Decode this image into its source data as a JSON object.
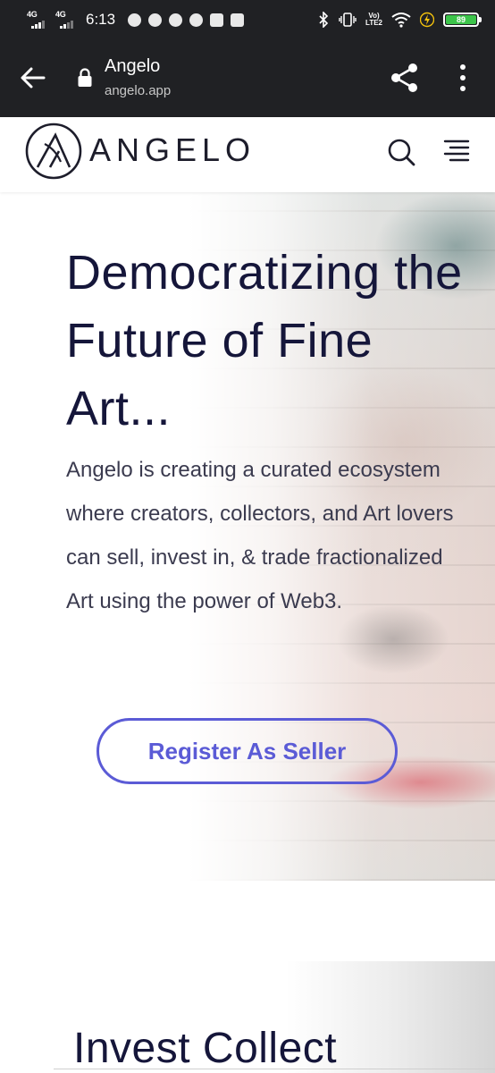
{
  "status_bar": {
    "network1": "4G",
    "network2": "4G",
    "time": "6:13",
    "volte_top": "Vo)",
    "volte_bottom": "LTE2",
    "battery": "89",
    "battery_color": "#3cc44a"
  },
  "browser": {
    "title": "Angelo",
    "url": "angelo.app"
  },
  "header": {
    "logo_text": "ANGELO"
  },
  "hero": {
    "title": "Democratizing the Future of Fine Art...",
    "description": "Angelo is creating a curated ecosystem where creators, collectors, and Art lovers can sell, invest in, & trade fractionalized Art using the power of Web3.",
    "register_button": "Register As Seller"
  },
  "section2": {
    "title": "Invest Collect"
  },
  "colors": {
    "accent": "#5b5bd6",
    "heading": "#15163a",
    "chrome_bg": "#202124"
  }
}
